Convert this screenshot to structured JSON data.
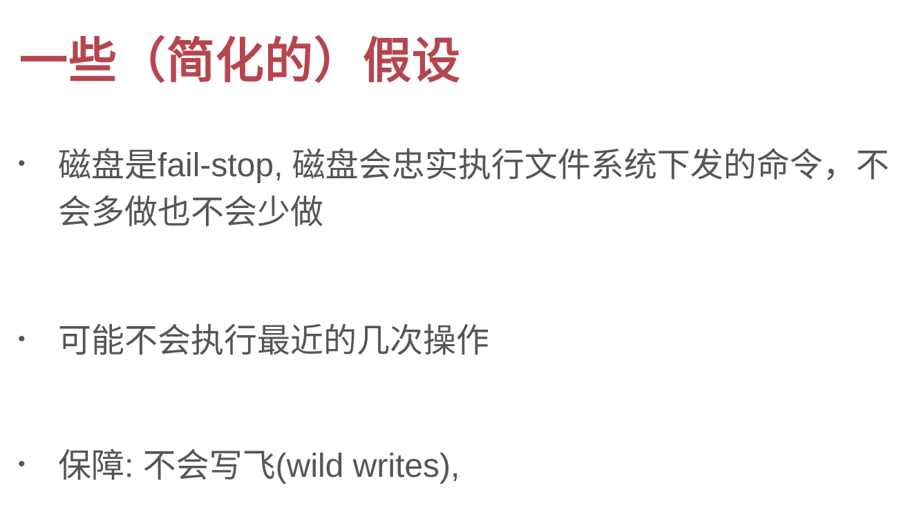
{
  "slide": {
    "title": "一些（简化的）假设",
    "bullets": [
      {
        "marker": "•",
        "text": "磁盘是fail-stop, 磁盘会忠实执行文件系统下发的命令，不会多做也不会少做"
      },
      {
        "marker": "•",
        "text": "可能不会执行最近的几次操作"
      },
      {
        "marker": "•",
        "text": "保障: 不会写飞(wild writes),"
      }
    ]
  },
  "colors": {
    "title": "#b5464f",
    "body_text": "#555555",
    "background": "#ffffff"
  }
}
